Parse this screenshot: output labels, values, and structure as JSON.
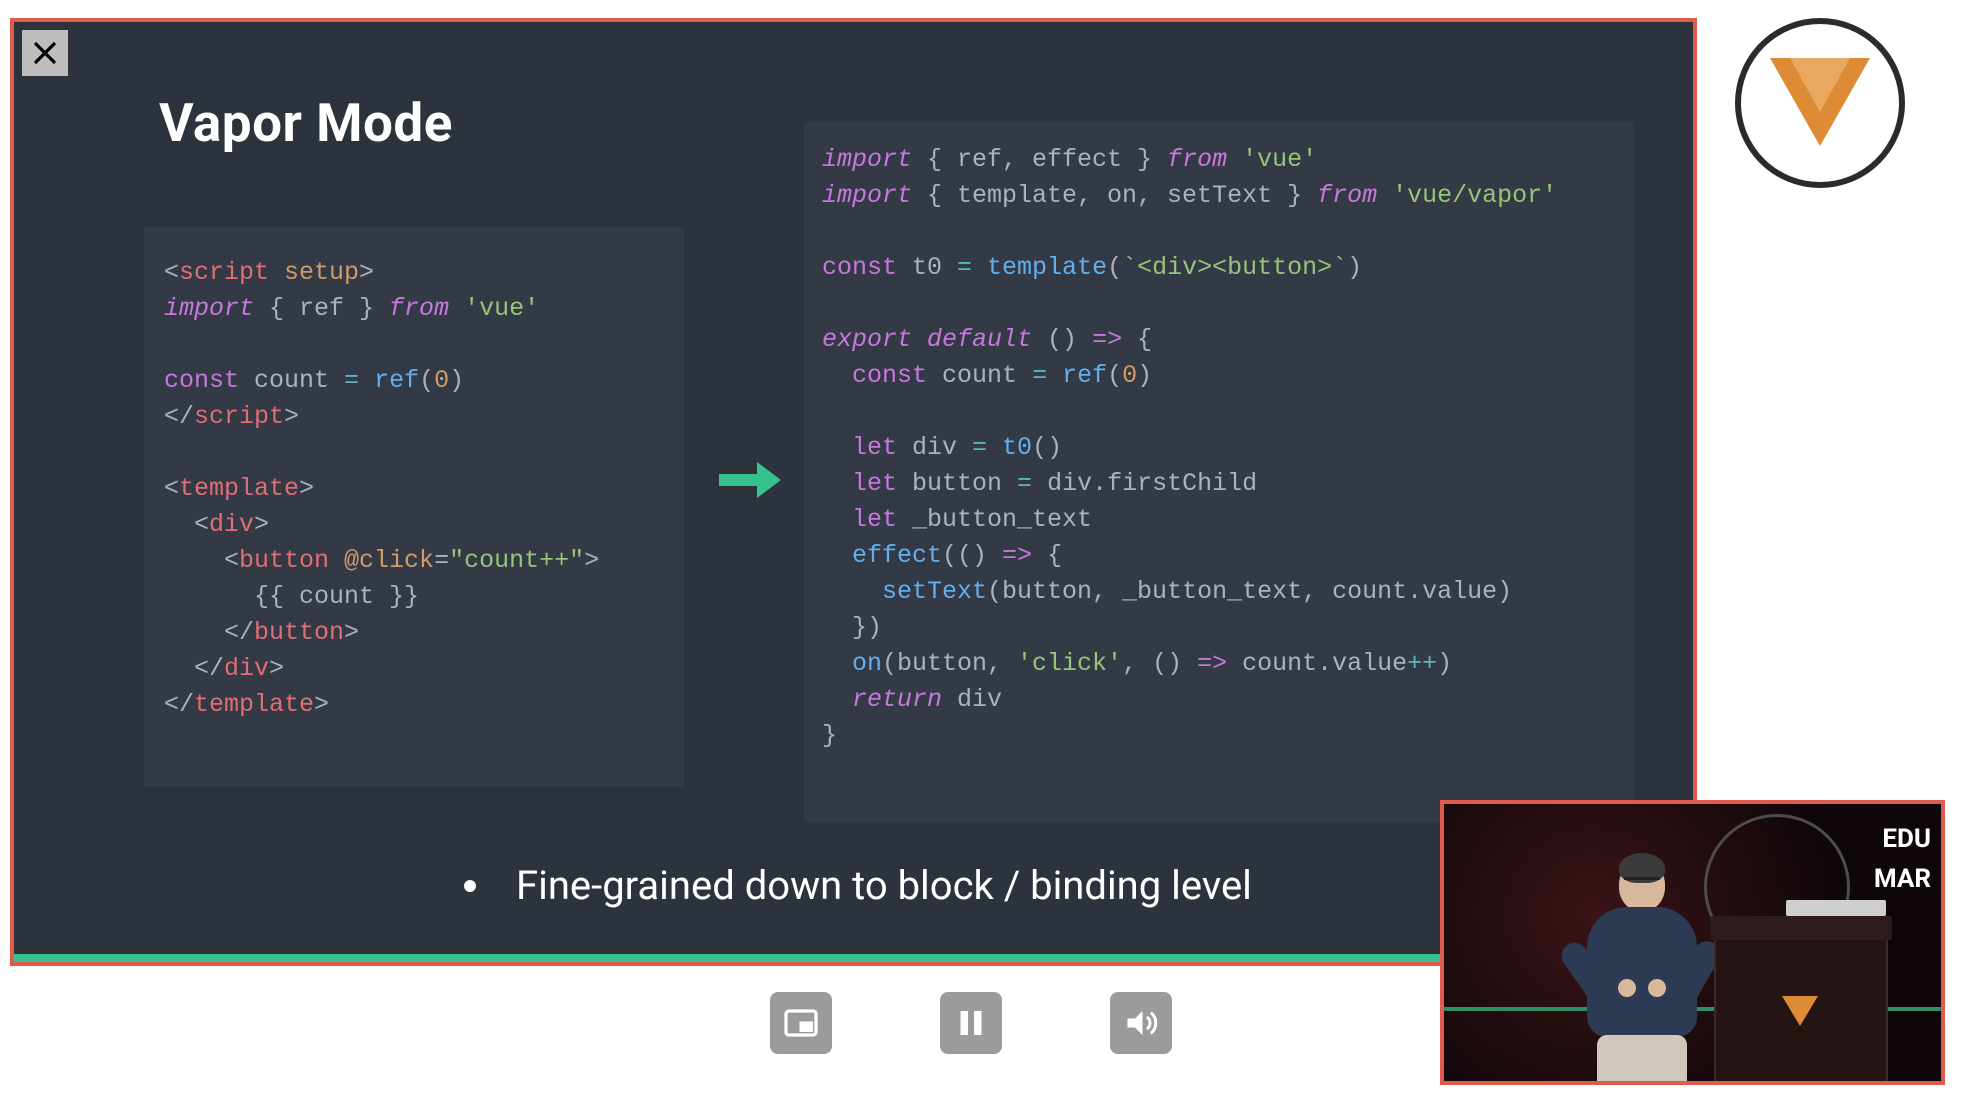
{
  "slide": {
    "title": "Vapor Mode",
    "bullet": "Fine-grained down to block / binding level",
    "progress_percent": 88,
    "code_left": {
      "l1_a": "<",
      "l1_b": "script",
      "l1_c": " setup",
      "l1_d": ">",
      "l2_a": "import",
      "l2_b": " { ref } ",
      "l2_c": "from",
      "l2_d": " 'vue'",
      "l3": "",
      "l4_a": "const",
      "l4_b": " count ",
      "l4_c": "=",
      "l4_d": " ref",
      "l4_e": "(",
      "l4_f": "0",
      "l4_g": ")",
      "l5_a": "</",
      "l5_b": "script",
      "l5_c": ">",
      "l6": "",
      "l7_a": "<",
      "l7_b": "template",
      "l7_c": ">",
      "l8_a": "  <",
      "l8_b": "div",
      "l8_c": ">",
      "l9_a": "    <",
      "l9_b": "button",
      "l9_c": " @click",
      "l9_d": "=",
      "l9_e": "\"count++\"",
      "l9_f": ">",
      "l10": "      {{ count }}",
      "l11_a": "    </",
      "l11_b": "button",
      "l11_c": ">",
      "l12_a": "  </",
      "l12_b": "div",
      "l12_c": ">",
      "l13_a": "</",
      "l13_b": "template",
      "l13_c": ">"
    },
    "code_right": {
      "l1_a": "import",
      "l1_b": " { ref, effect } ",
      "l1_c": "from",
      "l1_d": " 'vue'",
      "l2_a": "import",
      "l2_b": " { template, on, setText } ",
      "l2_c": "from",
      "l2_d": " 'vue/vapor'",
      "l3": "",
      "l4_a": "const",
      "l4_b": " t0 ",
      "l4_c": "=",
      "l4_d": " template",
      "l4_e": "(",
      "l4_f": "`<div><button>`",
      "l4_g": ")",
      "l5": "",
      "l6_a": "export",
      "l6_b": " default",
      "l6_c": " () ",
      "l6_d": "=>",
      "l6_e": " {",
      "l7_a": "  const",
      "l7_b": " count ",
      "l7_c": "=",
      "l7_d": " ref",
      "l7_e": "(",
      "l7_f": "0",
      "l7_g": ")",
      "l8": "",
      "l9_a": "  let",
      "l9_b": " div ",
      "l9_c": "=",
      "l9_d": " t0",
      "l9_e": "()",
      "l10_a": "  let",
      "l10_b": " button ",
      "l10_c": "=",
      "l10_d": " div.firstChild",
      "l11_a": "  let",
      "l11_b": " _button_text",
      "l12_a": "  effect",
      "l12_b": "(() ",
      "l12_c": "=>",
      "l12_d": " {",
      "l13_a": "    setText",
      "l13_b": "(button, _button_text, count.value)",
      "l14": "  })",
      "l15_a": "  on",
      "l15_b": "(button, ",
      "l15_c": "'click'",
      "l15_d": ", () ",
      "l15_e": "=>",
      "l15_f": " count.value",
      "l15_g": "++",
      "l15_h": ")",
      "l16_a": "  return",
      "l16_b": " div",
      "l17": "}"
    }
  },
  "pip": {
    "label1": "EDU",
    "label2": "MAR"
  },
  "controls": {
    "pip_toggle": "Picture-in-picture",
    "pause": "Pause",
    "volume": "Volume"
  },
  "close_label": "Close"
}
